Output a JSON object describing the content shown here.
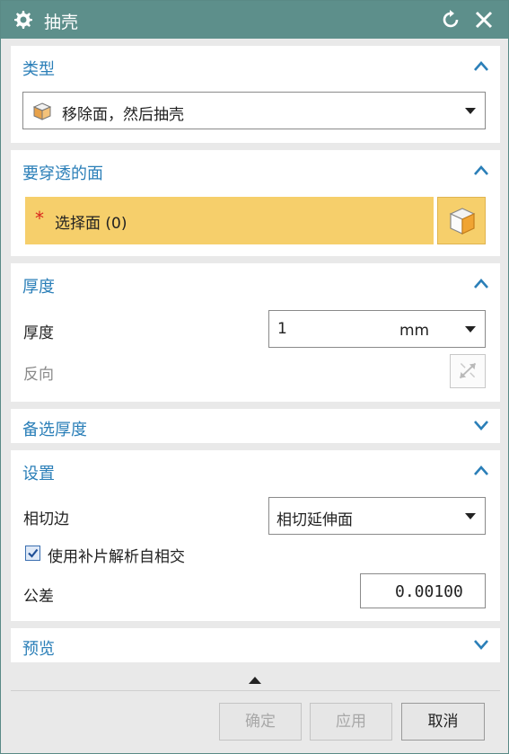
{
  "titlebar": {
    "title": "抽壳"
  },
  "type_section": {
    "title": "类型",
    "selected": "移除面，然后抽壳"
  },
  "faces_section": {
    "title": "要穿透的面",
    "required_mark": "*",
    "select_label": "选择面 (0)"
  },
  "thickness_section": {
    "title": "厚度",
    "thickness_label": "厚度",
    "thickness_value": "1",
    "unit": "mm",
    "reverse_label": "反向"
  },
  "alt_thickness_section": {
    "title": "备选厚度"
  },
  "settings_section": {
    "title": "设置",
    "tangent_edge_label": "相切边",
    "tangent_edge_value": "相切延伸面",
    "patch_checkbox_label": "使用补片解析自相交",
    "patch_checked": true,
    "tolerance_label": "公差",
    "tolerance_value": "0.00100"
  },
  "preview_section": {
    "title": "预览"
  },
  "footer": {
    "ok_label": "确定",
    "apply_label": "应用",
    "cancel_label": "取消"
  },
  "colors": {
    "titlebar": "#5d8f8b",
    "section_title": "#2b7fb8",
    "selection_highlight": "#f6cf6b",
    "required_star": "#d9261c"
  },
  "icons": [
    "gear-icon",
    "reset-icon",
    "close-icon",
    "chevron-up-icon",
    "chevron-down-icon",
    "solid-box-icon",
    "cube-select-icon",
    "reverse-direction-icon",
    "checkbox-checked-icon",
    "expand-up-icon"
  ]
}
